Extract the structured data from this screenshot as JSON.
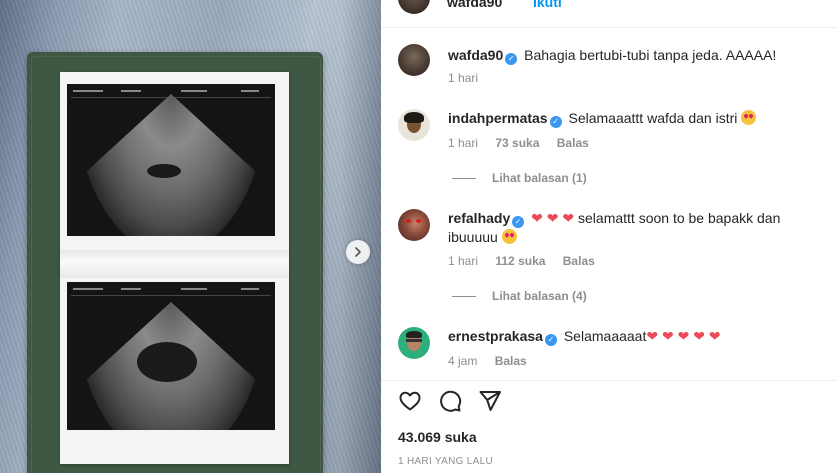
{
  "header": {
    "username": "wafda90",
    "follow_label": "Ikuti"
  },
  "photo": {
    "carousel_next_icon": "chevron-right-icon"
  },
  "caption": {
    "username": "wafda90",
    "text": "Bahagia bertubi-tubi tanpa jeda. AAAAA!",
    "time": "1 hari"
  },
  "comments": [
    {
      "username": "indahpermatas",
      "text": "Selamaaattt wafda dan istri",
      "emoji": "smiling-face-with-heart-eyes",
      "time": "1 hari",
      "likes": "73 suka",
      "reply_label": "Balas",
      "view_replies": "Lihat balasan (1)"
    },
    {
      "username": "refalhady",
      "text": "selamattt soon to be bapakk dan ibuuuuu",
      "emoji": "smiling-face-with-heart-eyes",
      "time": "1 hari",
      "likes": "112 suka",
      "reply_label": "Balas",
      "view_replies": "Lihat balasan (4)"
    },
    {
      "username": "ernestprakasa",
      "text": "Selamaaaaat",
      "time": "4 jam",
      "reply_label": "Balas"
    }
  ],
  "actions": {
    "like_icon": "heart-icon",
    "comment_icon": "comment-bubble-icon",
    "share_icon": "paper-plane-icon"
  },
  "post": {
    "likes": "43.069 suka",
    "timestamp": "1 HARI YANG LALU"
  },
  "colors": {
    "link_blue": "#0095f6",
    "verified_blue": "#3897f0",
    "heart_red": "#ed4956",
    "muted": "#8e8e8e",
    "folder_green": "#3e5843"
  }
}
